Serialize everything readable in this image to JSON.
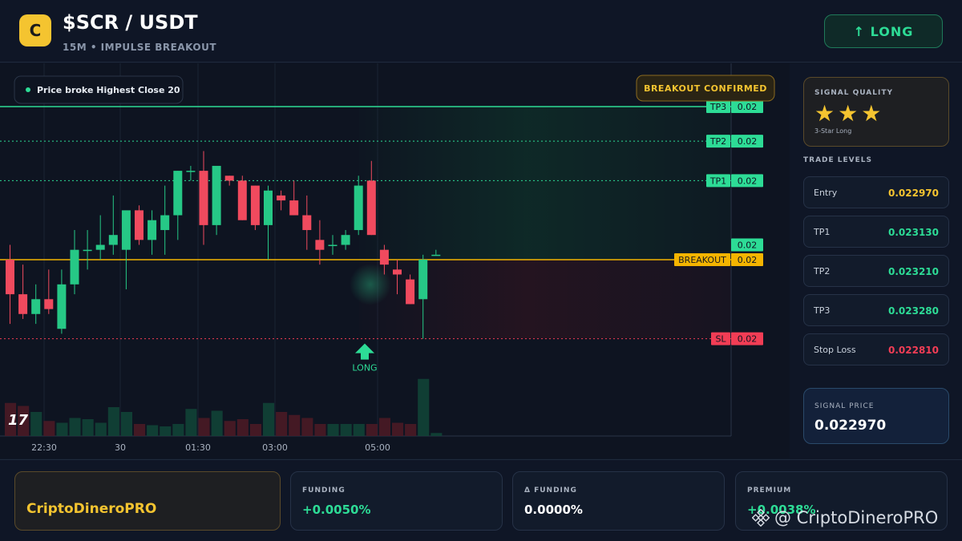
{
  "header": {
    "logo": "C",
    "title": "$SCR / USDT",
    "subtitle": "15M • IMPULSE BREAKOUT",
    "button": "↑ LONG"
  },
  "chart_data": {
    "type": "candlestick",
    "x_ticks": [
      "22:30",
      "30",
      "01:30",
      "03:00",
      "05:00"
    ],
    "candles": [
      {
        "o": 0.02297,
        "h": 0.023,
        "l": 0.02284,
        "c": 0.0229
      },
      {
        "o": 0.0229,
        "h": 0.02296,
        "l": 0.02285,
        "c": 0.02286
      },
      {
        "o": 0.02286,
        "h": 0.02292,
        "l": 0.02284,
        "c": 0.02289
      },
      {
        "o": 0.02289,
        "h": 0.02295,
        "l": 0.02286,
        "c": 0.02287
      },
      {
        "o": 0.02283,
        "h": 0.02295,
        "l": 0.02282,
        "c": 0.02292
      },
      {
        "o": 0.02292,
        "h": 0.02303,
        "l": 0.0229,
        "c": 0.02299
      },
      {
        "o": 0.02299,
        "h": 0.02303,
        "l": 0.02295,
        "c": 0.02299
      },
      {
        "o": 0.02299,
        "h": 0.02306,
        "l": 0.02297,
        "c": 0.023
      },
      {
        "o": 0.023,
        "h": 0.0231,
        "l": 0.02298,
        "c": 0.02302
      },
      {
        "o": 0.02299,
        "h": 0.02305,
        "l": 0.02291,
        "c": 0.02307
      },
      {
        "o": 0.02307,
        "h": 0.02308,
        "l": 0.023,
        "c": 0.02301
      },
      {
        "o": 0.02301,
        "h": 0.02307,
        "l": 0.02298,
        "c": 0.02305
      },
      {
        "o": 0.02303,
        "h": 0.02312,
        "l": 0.02298,
        "c": 0.02306
      },
      {
        "o": 0.02306,
        "h": 0.02315,
        "l": 0.02301,
        "c": 0.02315
      },
      {
        "o": 0.02315,
        "h": 0.02316,
        "l": 0.02313,
        "c": 0.02315
      },
      {
        "o": 0.02315,
        "h": 0.02319,
        "l": 0.023,
        "c": 0.02304
      },
      {
        "o": 0.02304,
        "h": 0.02315,
        "l": 0.02302,
        "c": 0.02316
      },
      {
        "o": 0.02314,
        "h": 0.02314,
        "l": 0.02312,
        "c": 0.02313
      },
      {
        "o": 0.02313,
        "h": 0.02314,
        "l": 0.02305,
        "c": 0.02305
      },
      {
        "o": 0.02312,
        "h": 0.02312,
        "l": 0.02303,
        "c": 0.02304
      },
      {
        "o": 0.02304,
        "h": 0.02312,
        "l": 0.02297,
        "c": 0.02311
      },
      {
        "o": 0.0231,
        "h": 0.02311,
        "l": 0.02307,
        "c": 0.02309
      },
      {
        "o": 0.02309,
        "h": 0.02313,
        "l": 0.02306,
        "c": 0.02306
      },
      {
        "o": 0.02306,
        "h": 0.0231,
        "l": 0.02299,
        "c": 0.02303
      },
      {
        "o": 0.02301,
        "h": 0.02305,
        "l": 0.02296,
        "c": 0.02299
      },
      {
        "o": 0.023,
        "h": 0.02302,
        "l": 0.02298,
        "c": 0.023
      },
      {
        "o": 0.023,
        "h": 0.02303,
        "l": 0.02299,
        "c": 0.02302
      },
      {
        "o": 0.02303,
        "h": 0.02314,
        "l": 0.02302,
        "c": 0.02312
      },
      {
        "o": 0.02313,
        "h": 0.02317,
        "l": 0.02302,
        "c": 0.02302
      },
      {
        "o": 0.02299,
        "h": 0.023,
        "l": 0.02294,
        "c": 0.02296
      },
      {
        "o": 0.02295,
        "h": 0.02297,
        "l": 0.0229,
        "c": 0.02294
      },
      {
        "o": 0.02293,
        "h": 0.02294,
        "l": 0.02288,
        "c": 0.02288
      },
      {
        "o": 0.02289,
        "h": 0.02298,
        "l": 0.02281,
        "c": 0.02297
      },
      {
        "o": 0.02298,
        "h": 0.02299,
        "l": 0.02298,
        "c": 0.02298
      }
    ],
    "volumes": [
      0.55,
      0.5,
      0.4,
      0.25,
      0.22,
      0.3,
      0.28,
      0.22,
      0.48,
      0.4,
      0.2,
      0.18,
      0.16,
      0.2,
      0.45,
      0.3,
      0.42,
      0.25,
      0.28,
      0.2,
      0.55,
      0.4,
      0.35,
      0.3,
      0.2,
      0.2,
      0.2,
      0.2,
      0.2,
      0.3,
      0.22,
      0.2,
      0.95,
      0.05
    ],
    "levels": [
      {
        "name": "TP3",
        "value": 0.02328,
        "label": "0.02",
        "color": "#2ddc96"
      },
      {
        "name": "TP2",
        "value": 0.02321,
        "label": "0.02",
        "color": "#2ddc96"
      },
      {
        "name": "TP1",
        "value": 0.02313,
        "label": "0.02",
        "color": "#2ddc96"
      },
      {
        "name": "BREAKOUT",
        "value": 0.02297,
        "label": "0.02",
        "color": "#f4b400"
      },
      {
        "name": "SL",
        "value": 0.02281,
        "label": "0.02",
        "color": "#f23d55"
      }
    ],
    "current_price_label": "0.02",
    "annotation_left": "Price broke Highest Close 20",
    "annotation_right": "BREAKOUT CONFIRMED",
    "signal_marker": "LONG"
  },
  "side": {
    "quality_label": "SIGNAL QUALITY",
    "stars": "★★★",
    "quality_sub": "3-Star Long",
    "levels_label": "TRADE LEVELS",
    "rows": [
      {
        "k": "Entry",
        "v": "0.022970",
        "color": "#f4c430"
      },
      {
        "k": "TP1",
        "v": "0.023130",
        "color": "#2ddc96"
      },
      {
        "k": "TP2",
        "v": "0.023210",
        "color": "#2ddc96"
      },
      {
        "k": "TP3",
        "v": "0.023280",
        "color": "#2ddc96"
      },
      {
        "k": "Stop Loss",
        "v": "0.022810",
        "color": "#f23d55"
      }
    ],
    "signal_price_label": "SIGNAL PRICE",
    "signal_price": "0.022970"
  },
  "footer": {
    "brand": "CriptoDineroPRO",
    "cards": [
      {
        "k": "FUNDING",
        "v": "+0.0050%",
        "color": "#2ddc96"
      },
      {
        "k": "Δ FUNDING",
        "v": "0.0000%",
        "color": "#ffffff"
      },
      {
        "k": "PREMIUM",
        "v": "+0.0038%",
        "color": "#2ddc96"
      }
    ],
    "watermark": "@ CriptoDineroPRO",
    "tv_logo": "17"
  }
}
